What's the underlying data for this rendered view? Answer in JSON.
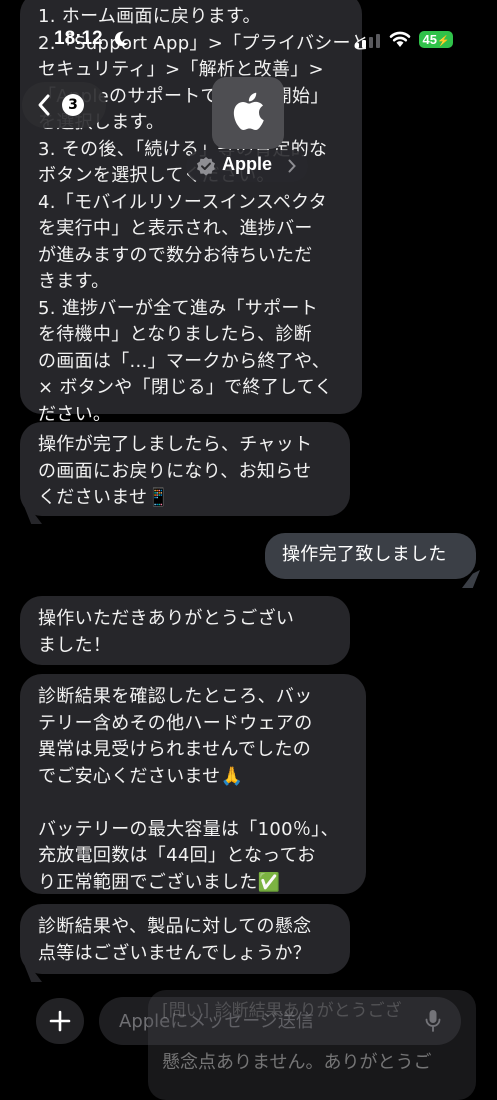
{
  "status_bar": {
    "time": "18:12",
    "battery": "45",
    "moon_icon": "moon-icon",
    "signal_icon": "cellular-signal-icon",
    "wifi_icon": "wifi-icon"
  },
  "header": {
    "unread_count": "3",
    "contact_name": "Apple",
    "back_icon": "chevron-left-icon",
    "avatar_icon": "apple-logo-icon",
    "verified_icon": "verified-badge-icon"
  },
  "messages": [
    {
      "sender": "them",
      "lines": [
        "1. ホーム画面に戻ります。",
        "2.「Support App」>「プライバシーと",
        "セキュリティ」>「解析と改善」>",
        "「Appleのサポートで診断を開始」",
        "を選択します。",
        "3. その後、「続ける」等の肯定的な",
        "ボタンを選択してください。",
        "4.「モバイルリソースインスペクタ",
        "を実行中」と表示され、進捗バー",
        "が進みますので数分お待ちいただ",
        "きます。",
        "5. 進捗バーが全て進み「サポート",
        "を待機中」となりましたら、診断",
        "の画面は「...」マークから終了や、",
        "× ボタンや「閉じる」で終了してく",
        "ださい。"
      ]
    },
    {
      "sender": "them",
      "lines": [
        "操作が完了しましたら、チャット",
        "の画面にお戻りになり、お知らせ",
        "くださいませ📱"
      ]
    },
    {
      "sender": "me",
      "lines": [
        "操作完了致しました"
      ]
    },
    {
      "sender": "them",
      "lines": [
        "操作いただきありがとうござい",
        "ました！"
      ]
    },
    {
      "sender": "them",
      "lines": [
        "診断結果を確認したところ、バッ",
        "テリー含めその他ハードウェアの",
        "異常は見受けられませんでしたの",
        "でご安心くださいませ🙏",
        "",
        "バッテリーの最大容量は「100％」、",
        "充放電回数は「44回」となってお",
        "り正常範囲でございました✅"
      ]
    },
    {
      "sender": "them",
      "lines": [
        "診断結果や、製品に対しての懸念",
        "点等はございませんでしょうか？"
      ]
    }
  ],
  "input_bar": {
    "placeholder": "Appleにメッセージ送信",
    "plus_icon": "plus-icon",
    "mic_icon": "microphone-icon"
  },
  "notification": {
    "title": "[問い] 診断結果ありがとうござ",
    "body": "懸念点ありません。ありがとうご"
  },
  "colors": {
    "incoming_bubble": "#26262a",
    "outgoing_bubble": "#3b3f46",
    "battery_green": "#30c24a"
  }
}
